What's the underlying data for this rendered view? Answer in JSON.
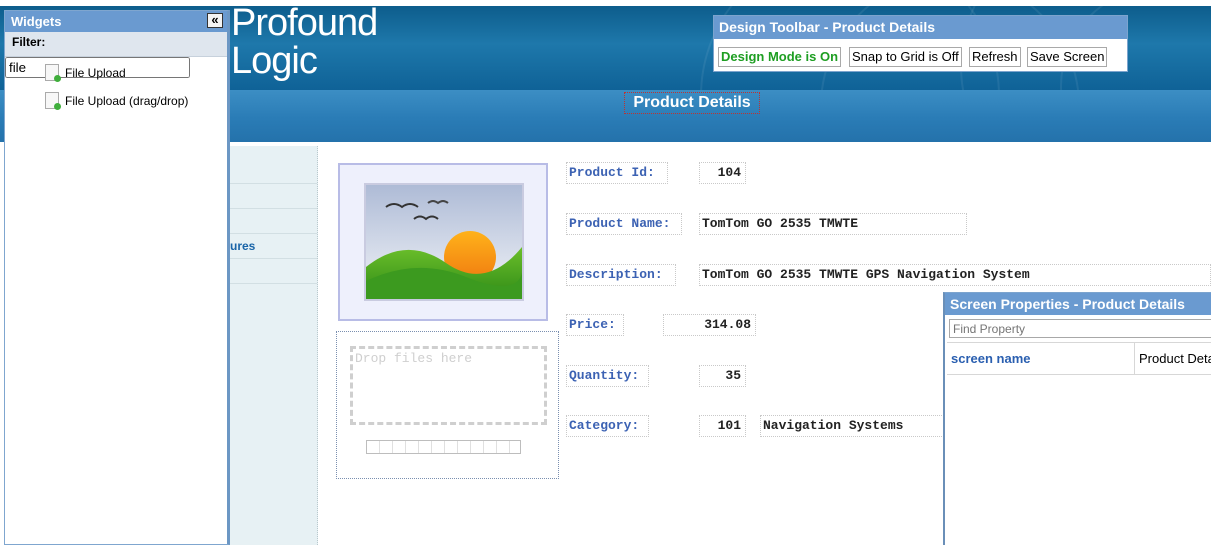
{
  "logo": {
    "line1": "Profound",
    "line2": "Logic"
  },
  "page": {
    "title": "Product Details"
  },
  "nav": {
    "partial_item": "ures"
  },
  "upload": {
    "drop_text": "Drop files here"
  },
  "fields": {
    "product_id": {
      "label": "Product Id:",
      "value": "104"
    },
    "product_name": {
      "label": "Product Name:",
      "value": "TomTom GO 2535 TMWTE"
    },
    "description": {
      "label": "Description:",
      "value": "TomTom GO 2535 TMWTE GPS Navigation System"
    },
    "price": {
      "label": "Price:",
      "value": "314.08"
    },
    "quantity": {
      "label": "Quantity:",
      "value": "35"
    },
    "category": {
      "label": "Category:",
      "code": "101",
      "name": "Navigation Systems"
    }
  },
  "widgets_panel": {
    "title": "Widgets",
    "collapse_glyph": "«",
    "filter_label": "Filter:",
    "filter_value": "file",
    "items": [
      {
        "label": "File Upload",
        "icon": "file-upload-icon"
      },
      {
        "label": "File Upload (drag/drop)",
        "icon": "file-upload-icon"
      }
    ]
  },
  "design_toolbar": {
    "title": "Design Toolbar - Product Details",
    "design_mode": "Design Mode is On",
    "snap": "Snap to Grid is Off",
    "refresh": "Refresh",
    "save": "Save Screen",
    "design_mode_color": "#1e9e22"
  },
  "screen_properties": {
    "title": "Screen Properties - Product Details",
    "search_placeholder": "Find Property",
    "rows": [
      {
        "key": "screen name",
        "value": "Product Deta"
      }
    ]
  },
  "colors": {
    "panel_header": "#6a9ad0",
    "label_blue": "#3c62b3",
    "banner": "#0d5d8c"
  }
}
